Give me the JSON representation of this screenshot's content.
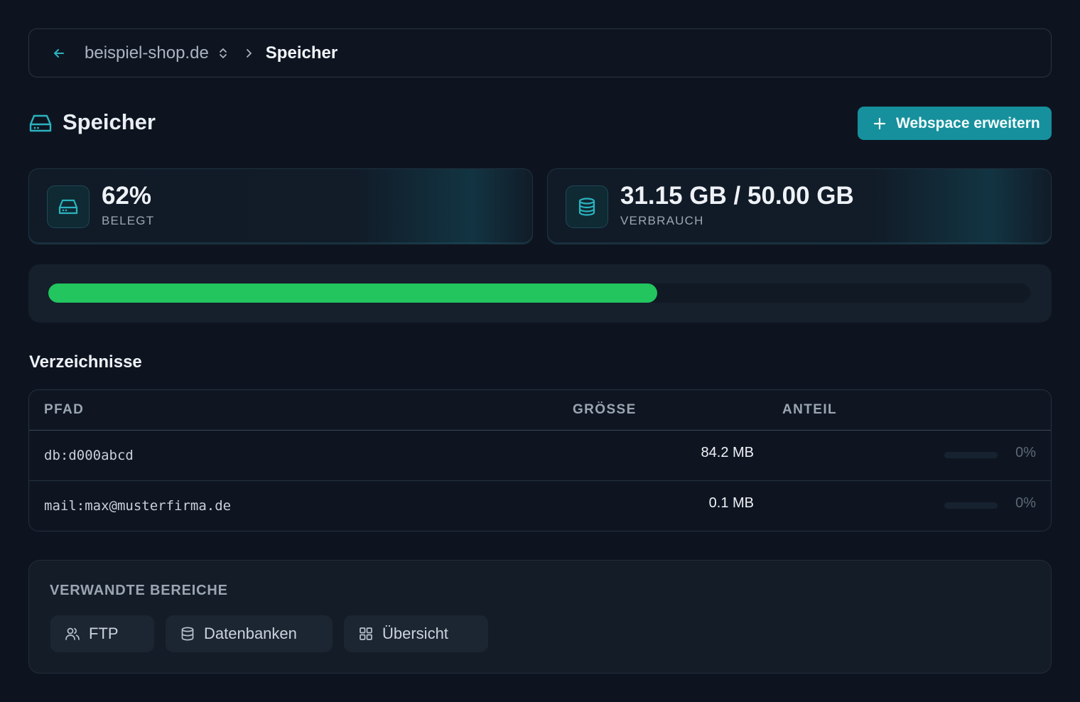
{
  "breadcrumb": {
    "back_icon": "arrow-left-icon",
    "site": "beispiel-shop.de",
    "switch_icon": "chevron-up-down-icon",
    "separator_icon": "chevron-right-icon",
    "current": "Speicher"
  },
  "header": {
    "icon": "hard-drive-icon",
    "title": "Speicher",
    "action_icon": "plus-icon",
    "action_label": "Webspace erweitern"
  },
  "stats": [
    {
      "icon": "hard-drive-icon",
      "value": "62%",
      "label": "BELEGT"
    },
    {
      "icon": "database-icon",
      "value": "31.15 GB / 50.00 GB",
      "label": "VERBRAUCH"
    }
  ],
  "usage": {
    "percent": 62,
    "used_gb": 31.15,
    "total_gb": 50.0
  },
  "directories": {
    "title": "Verzeichnisse",
    "columns": [
      "PFAD",
      "GRÖSSE",
      "ANTEIL"
    ],
    "rows": [
      {
        "path": "db:d000abcd",
        "size": "84.2 MB",
        "share": "0%",
        "share_value": 0
      },
      {
        "path": "mail:max@musterfirma.de",
        "size": "0.1 MB",
        "share": "0%",
        "share_value": 0
      }
    ]
  },
  "related": {
    "title": "VERWANDTE BEREICHE",
    "links": [
      {
        "label": "FTP",
        "icon": "users-icon"
      },
      {
        "label": "Datenbanken",
        "icon": "database-icon"
      },
      {
        "label": "Übersicht",
        "icon": "grid-icon"
      }
    ]
  },
  "colors": {
    "background": "#0d1420",
    "accent": "#16909c",
    "progress": "#22c55e",
    "icon_teal": "#2bb3bf"
  }
}
